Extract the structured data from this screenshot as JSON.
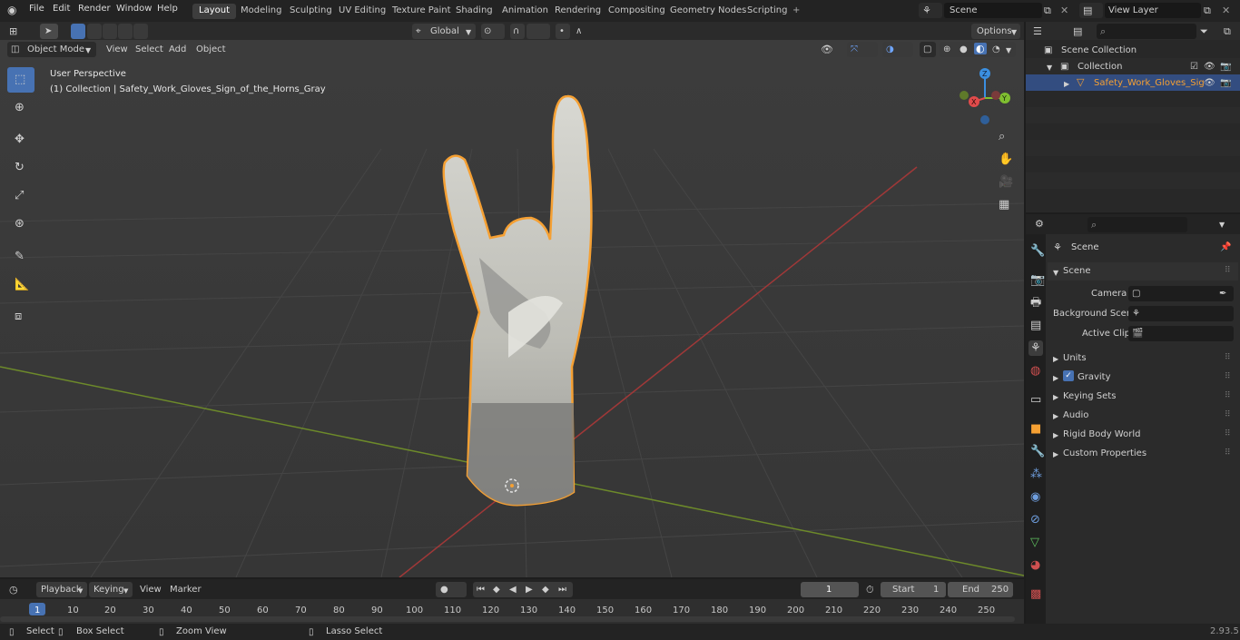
{
  "topbar": {
    "menus": [
      "File",
      "Edit",
      "Render",
      "Window",
      "Help"
    ],
    "workspaces": [
      "Layout",
      "Modeling",
      "Sculpting",
      "UV Editing",
      "Texture Paint",
      "Shading",
      "Animation",
      "Rendering",
      "Compositing",
      "Geometry Nodes",
      "Scripting"
    ],
    "active_workspace": "Layout",
    "add_tab": "+",
    "scene_name": "Scene",
    "view_layer_name": "View Layer"
  },
  "header3d": {
    "mode": "Object Mode",
    "menus": [
      "View",
      "Select",
      "Add",
      "Object"
    ],
    "transform_orientation": "Global",
    "options_label": "Options"
  },
  "viewport": {
    "perspective_label": "User Perspective",
    "collection_label": "(1) Collection | Safety_Work_Gloves_Sign_of_the_Horns_Gray",
    "gizmo": {
      "x": "X",
      "y": "Y",
      "z": "Z"
    }
  },
  "outliner": {
    "scene_collection": "Scene Collection",
    "collection": "Collection",
    "object": "Safety_Work_Gloves_Sig"
  },
  "properties": {
    "context_label": "Scene",
    "panel_title": "Scene",
    "camera_label": "Camera",
    "background_scene_label": "Background Scene",
    "active_clip_label": "Active Clip",
    "sections": [
      "Units",
      "Gravity",
      "Keying Sets",
      "Audio",
      "Rigid Body World",
      "Custom Properties"
    ],
    "gravity_checked": true
  },
  "timeline": {
    "menus": [
      "Playback",
      "Keying",
      "View",
      "Marker"
    ],
    "current_frame": "1",
    "start_label": "Start",
    "start_value": "1",
    "end_label": "End",
    "end_value": "250",
    "ruler_ticks": [
      "1",
      "10",
      "20",
      "30",
      "40",
      "50",
      "60",
      "70",
      "80",
      "90",
      "100",
      "110",
      "120",
      "130",
      "140",
      "150",
      "160",
      "170",
      "180",
      "190",
      "200",
      "210",
      "220",
      "230",
      "240",
      "250"
    ]
  },
  "statusbar": {
    "select": "Select",
    "box_select": "Box Select",
    "zoom_view": "Zoom View",
    "lasso_select": "Lasso Select",
    "version": "2.93.5"
  },
  "colors": {
    "accent": "#4772b3",
    "selection_outline": "#f5a033",
    "x_axis": "#a03838",
    "y_axis": "#6d8a2a",
    "gizmo_x": "#e14b4b",
    "gizmo_y": "#7fbf30",
    "gizmo_z": "#3b8fe0"
  }
}
